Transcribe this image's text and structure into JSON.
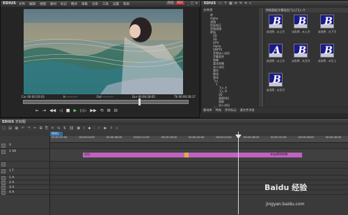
{
  "player": {
    "app_name": "EDIUS",
    "menu": [
      "文件",
      "编辑",
      "视图",
      "素材",
      "标记",
      "模式",
      "采集",
      "渲染",
      "工具",
      "设置",
      "帮助"
    ],
    "plr": "PLR",
    "rec": "REC",
    "timecodes": [
      "Cur 00:00:20:03",
      "In --:--:--:--",
      "Out --:--:--:--",
      "Dur 00:00:28:05",
      "Ttl 00:00:28:17"
    ]
  },
  "bin": {
    "name": "EDIUS",
    "folder_label": "文件夹",
    "tree_items": [
      "库",
      "Alpha",
      "滤镜",
      "色彩校正",
      "音频滤镜",
      "转场",
      "2D",
      "3D",
      "GPU",
      "Alpha",
      "SMPTE",
      "音频淡入淡出",
      "字幕混合",
      "划像",
      "柔化划像",
      "淡入淡出",
      "激光",
      "移动",
      "滚动",
      "飞入",
      "1",
      "飞入 A",
      "飞入 B",
      "3D",
      "滚屏(软)",
      "滚屏",
      "淡入淡出",
      "键控"
    ],
    "effects_header": "特效面板|字幕混合|飞入|飞入 A",
    "effects": [
      {
        "letter": "B",
        "label": "淡出线 - 从上方"
      },
      {
        "letter": "B",
        "label": "淡出线 - 从上方"
      },
      {
        "letter": "B",
        "label": "淡出线 - 从下方"
      },
      {
        "letter": "A",
        "label": "淡出线 - 从上方"
      },
      {
        "letter": "B",
        "label": "淡出线 - 从左方"
      },
      {
        "letter": "B",
        "label": "淡出线 - 从左上"
      },
      {
        "letter": "B",
        "label": "淡出线 - 从左方"
      }
    ],
    "tabs": [
      "素材库",
      "特效",
      "序列标记",
      "源文件浏览"
    ]
  },
  "timeline": {
    "name": "EDIUS",
    "project": "无标题",
    "sequence_tab": "序列1",
    "ruler_ticks": [
      "00:00:00:00",
      "00:00:04:00",
      "00:00:08:00",
      "00:00:12:00",
      "00:00:16:00",
      "00:00:20:00",
      "00:00:24:00",
      "00:00:28:00",
      "00:00:32:00",
      "00:00:36:00",
      "00:00:40:00"
    ],
    "tracks": [
      {
        "name": "V",
        "height": 9
      },
      {
        "name": "1 VA",
        "height": 18
      },
      {
        "name": "",
        "height": 10
      },
      {
        "name": "1 T",
        "height": 10
      },
      {
        "name": "1 A",
        "height": 7
      },
      {
        "name": "2 A",
        "height": 7
      },
      {
        "name": "3 A",
        "height": 7
      },
      {
        "name": "4 A",
        "height": 7
      }
    ],
    "clips": [
      {
        "label": "1(1)",
        "color": "#c062c0",
        "start_pct": 11,
        "width_pct": 34
      },
      {
        "label": "",
        "color": "#e0b040",
        "start_pct": 45,
        "width_pct": 1.5
      },
      {
        "label": "",
        "color": "#c062c0",
        "start_pct": 46.5,
        "width_pct": 27
      },
      {
        "label": "tmp0RA6AM",
        "color": "#c062c0",
        "start_pct": 73.5,
        "width_pct": 11
      }
    ],
    "playhead_pct": 63
  },
  "watermark": {
    "text": "Baidu 经验",
    "url": "jingyan.baidu.com"
  }
}
